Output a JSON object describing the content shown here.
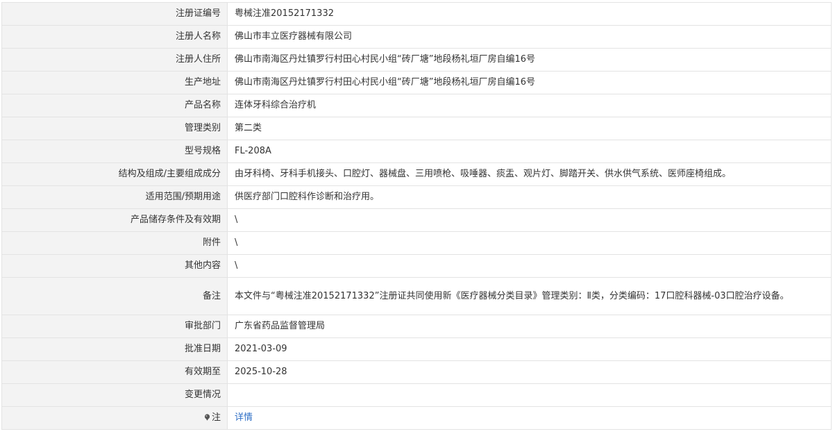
{
  "rows": [
    {
      "label": "注册证编号",
      "value": "粤械注准20152171332"
    },
    {
      "label": "注册人名称",
      "value": "佛山市丰立医疗器械有限公司"
    },
    {
      "label": "注册人住所",
      "value": "佛山市南海区丹灶镇罗行村田心村民小组“砖厂塘”地段杨礼垣厂房自编16号"
    },
    {
      "label": "生产地址",
      "value": "佛山市南海区丹灶镇罗行村田心村民小组“砖厂塘”地段杨礼垣厂房自编16号"
    },
    {
      "label": "产品名称",
      "value": "连体牙科综合治疗机"
    },
    {
      "label": "管理类别",
      "value": "第二类"
    },
    {
      "label": "型号规格",
      "value": "FL-208A"
    },
    {
      "label": "结构及组成/主要组成成分",
      "value": "由牙科椅、牙科手机接头、口腔灯、器械盘、三用喷枪、吸唾器、痰盂、观片灯、脚踏开关、供水供气系统、医师座椅组成。"
    },
    {
      "label": "适用范围/预期用途",
      "value": "供医疗部门口腔科作诊断和治疗用。"
    },
    {
      "label": "产品储存条件及有效期",
      "value": "\\"
    },
    {
      "label": "附件",
      "value": "\\"
    },
    {
      "label": "其他内容",
      "value": "\\"
    },
    {
      "label": "备注",
      "value": "本文件与“粤械注准20152171332”注册证共同使用新《医疗器械分类目录》管理类别：Ⅱ类，分类编码：17口腔科器械-03口腔治疗设备。"
    },
    {
      "label": "审批部门",
      "value": "广东省药品监督管理局"
    },
    {
      "label": "批准日期",
      "value": "2021-03-09"
    },
    {
      "label": "有效期至",
      "value": "2025-10-28"
    },
    {
      "label": "变更情况",
      "value": ""
    }
  ],
  "footer": {
    "label": "注",
    "icon": "pin-icon",
    "link_text": "详情",
    "link_color": "#2f6fc6"
  }
}
